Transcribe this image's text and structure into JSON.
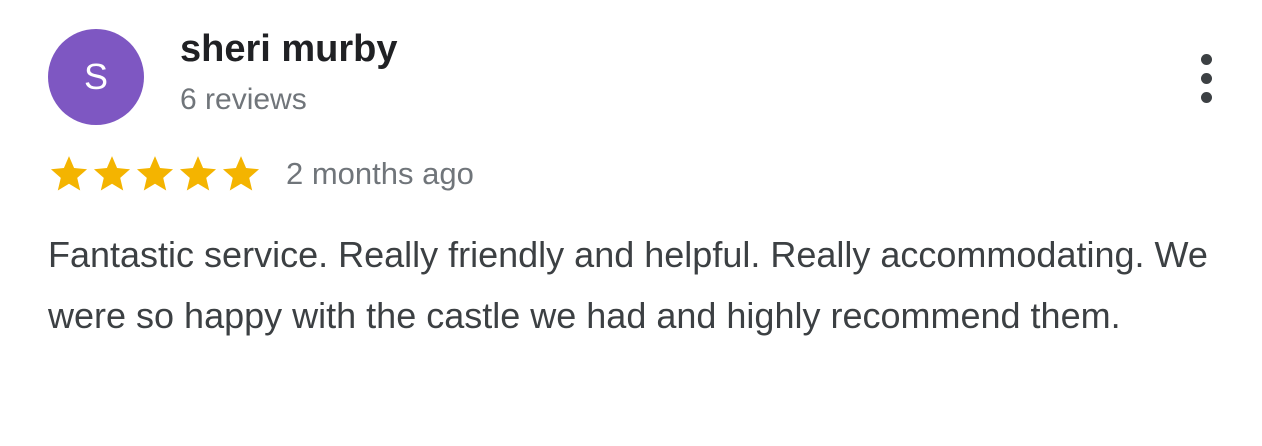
{
  "reviewer": {
    "initial": "S",
    "name": "sheri murby",
    "review_count": "6 reviews",
    "avatar_color": "#7e57c2"
  },
  "menu": {
    "icon": "more-vert-icon"
  },
  "rating": {
    "stars": 5,
    "max_stars": 5,
    "star_color": "#f4b400",
    "time": "2 months ago"
  },
  "review": {
    "text": "Fantastic service. Really friendly and helpful. Really accommodating. We were so happy with the castle we had and highly recommend them."
  }
}
